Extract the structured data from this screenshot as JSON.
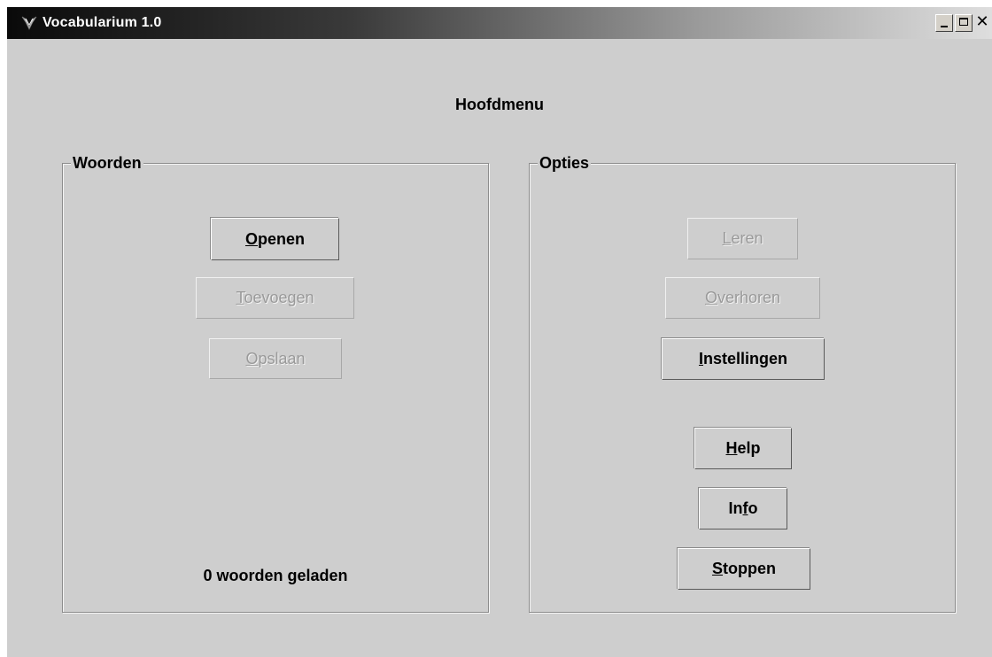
{
  "window": {
    "title": "Vocabularium 1.0",
    "minimize_symbol": "_",
    "maximize_symbol": "□",
    "close_symbol": "✕"
  },
  "page_title": "Hoofdmenu",
  "woorden": {
    "label": "Woorden",
    "buttons": [
      {
        "id": "openen",
        "mnemonic": "O",
        "rest": "penen",
        "enabled": true
      },
      {
        "id": "toevoegen",
        "mnemonic": "T",
        "rest": "oevoegen",
        "enabled": false
      },
      {
        "id": "opslaan",
        "mnemonic": "O",
        "rest": "pslaan",
        "enabled": false
      }
    ],
    "status": "0 woorden geladen"
  },
  "opties": {
    "label": "Opties",
    "buttons": [
      {
        "id": "leren",
        "mnemonic": "L",
        "rest": "eren",
        "enabled": false
      },
      {
        "id": "overhoren",
        "mnemonic": "O",
        "rest": "verhoren",
        "enabled": false
      },
      {
        "id": "instellingen",
        "mnemonic": "I",
        "rest": "nstellingen",
        "enabled": true
      },
      {
        "id": "help",
        "mnemonic": "H",
        "rest": "elp",
        "enabled": true
      },
      {
        "id": "info",
        "prefix": "In",
        "mnemonic": "f",
        "rest": "o",
        "enabled": true
      },
      {
        "id": "stoppen",
        "mnemonic": "S",
        "rest": "toppen",
        "enabled": true
      }
    ]
  },
  "colors": {
    "window_bg": "#cecece",
    "disabled_text": "#9a9a9a",
    "title_text": "#ffffff"
  }
}
